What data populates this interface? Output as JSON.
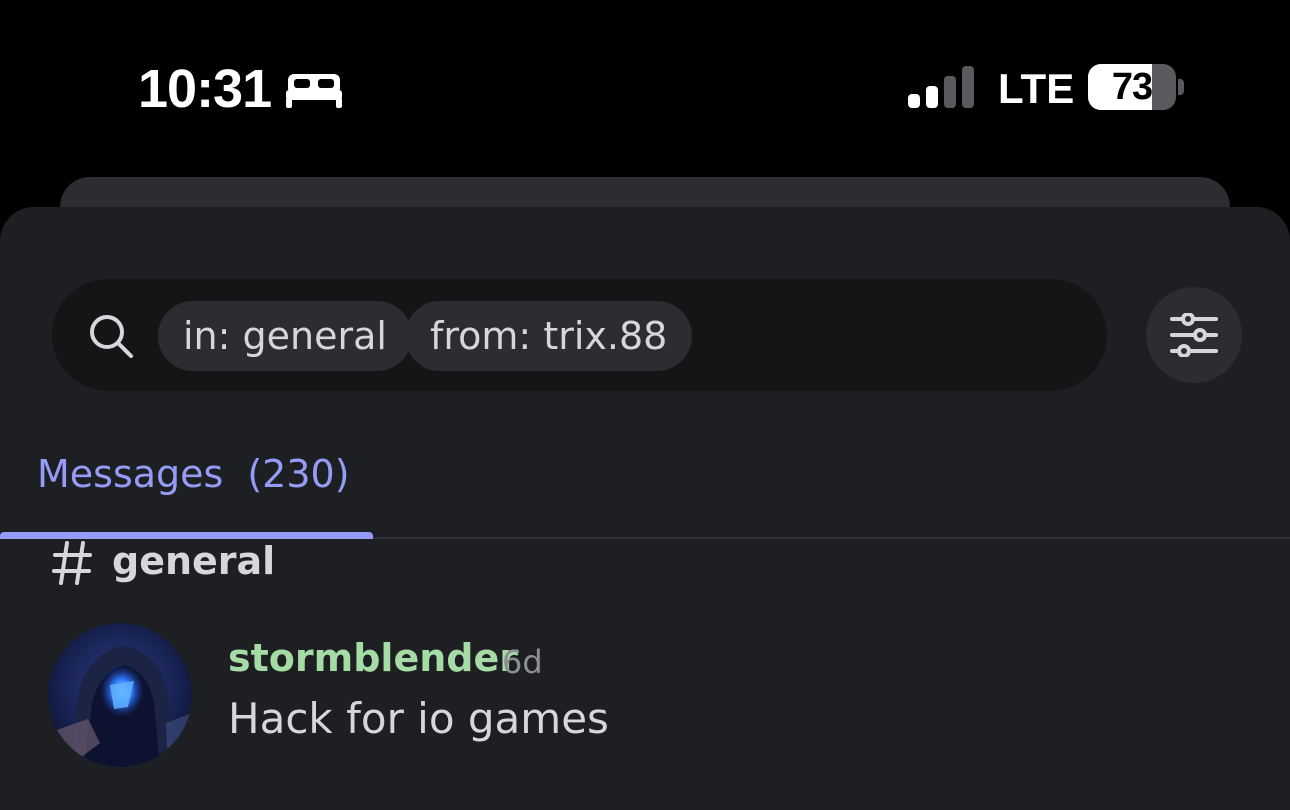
{
  "status_bar": {
    "time": "10:31",
    "focus_icon": "bed-icon",
    "signal_icon": "cellular-signal-icon",
    "network": "LTE",
    "battery": "73",
    "battery_level": 0.73
  },
  "search": {
    "icon": "search-icon",
    "chips": [
      "in: general",
      "from: trix.88"
    ],
    "filter_icon": "sliders-icon"
  },
  "tabs": [
    {
      "label": "Messages",
      "count": "(230)",
      "active": true
    }
  ],
  "results": {
    "channel": {
      "icon": "hash-icon",
      "name": "general"
    },
    "messages": [
      {
        "author": "stormblender",
        "time": "6d",
        "text": "Hack for io games",
        "author_color": "#a5dca6"
      }
    ]
  },
  "colors": {
    "accent": "#949cf7",
    "background": "#1e1f22",
    "search_bg": "#141517",
    "chip_bg": "#2b2d31"
  }
}
